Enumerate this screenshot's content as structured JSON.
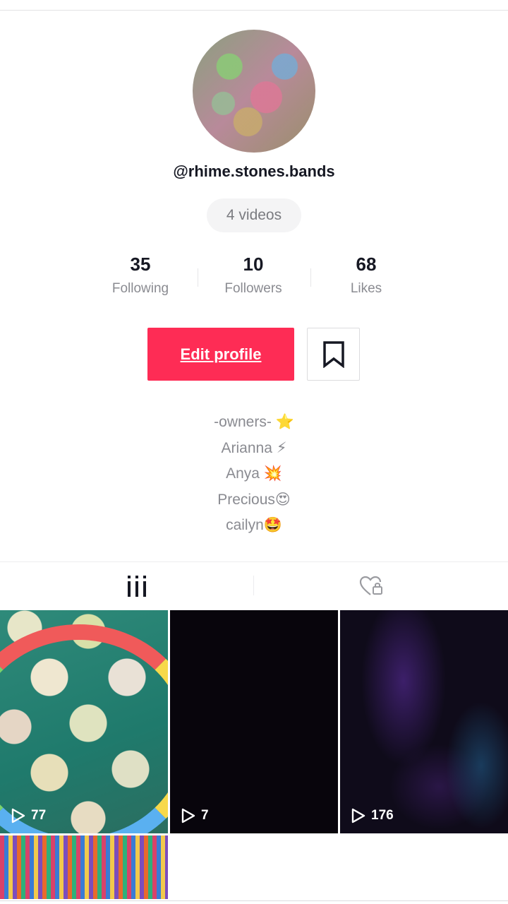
{
  "profile": {
    "username": "@rhime.stones.bands",
    "videos_label": "4 videos",
    "stats": [
      {
        "value": "35",
        "label": "Following"
      },
      {
        "value": "10",
        "label": "Followers"
      },
      {
        "value": "68",
        "label": "Likes"
      }
    ],
    "edit_button": "Edit profile",
    "bio": [
      "-owners- ⭐",
      "Arianna ⚡",
      "Anya 💥",
      "Precious😍",
      "cailyn🤩"
    ]
  },
  "tabs": {
    "videos_icon": "grid-columns-icon",
    "liked_icon": "heart-lock-icon"
  },
  "videos": [
    {
      "plays": "77"
    },
    {
      "plays": "7"
    },
    {
      "plays": "176"
    },
    {
      "plays": ""
    }
  ],
  "colors": {
    "accent": "#fe2c55",
    "text": "#161823",
    "muted": "#8a8b91"
  }
}
